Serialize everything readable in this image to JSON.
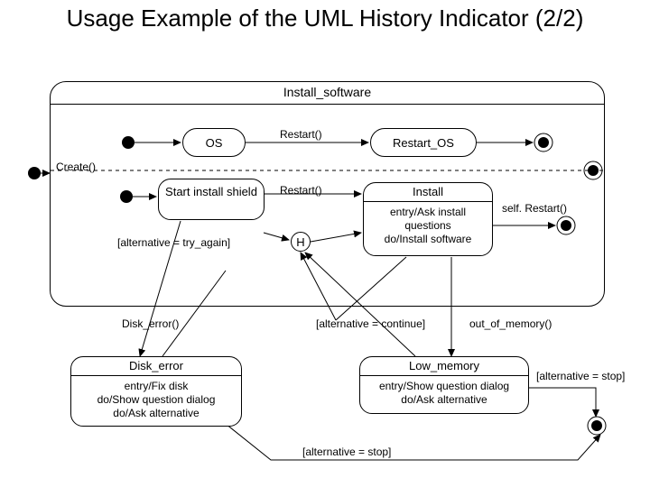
{
  "title": "Usage Example of the UML History Indicator (2/2)",
  "outer_state": "Install_software",
  "region1": {
    "state_os": "OS",
    "trans_restart": "Restart()",
    "state_restart_os": "Restart_OS"
  },
  "create_label": "Create()",
  "region2": {
    "state_shield": "Start install shield",
    "trans_restart": "Restart()",
    "guard_try_again": "[alternative = try_again]",
    "history": "H",
    "state_install": {
      "name": "Install",
      "entry": "entry/Ask install questions",
      "do": "do/Install software"
    },
    "self_restart": "self. Restart()"
  },
  "exits": {
    "disk_error": "Disk_error()",
    "alt_continue": "[alternative = continue]",
    "out_of_memory": "out_of_memory()"
  },
  "error_states": {
    "disk": {
      "name": "Disk_error",
      "entry": "entry/Fix disk",
      "do1": "do/Show question dialog",
      "do2": "do/Ask alternative"
    },
    "mem": {
      "name": "Low_memory",
      "entry": "entry/Show question dialog",
      "do": "do/Ask alternative"
    }
  },
  "alt_stop": "[alternative = stop]"
}
